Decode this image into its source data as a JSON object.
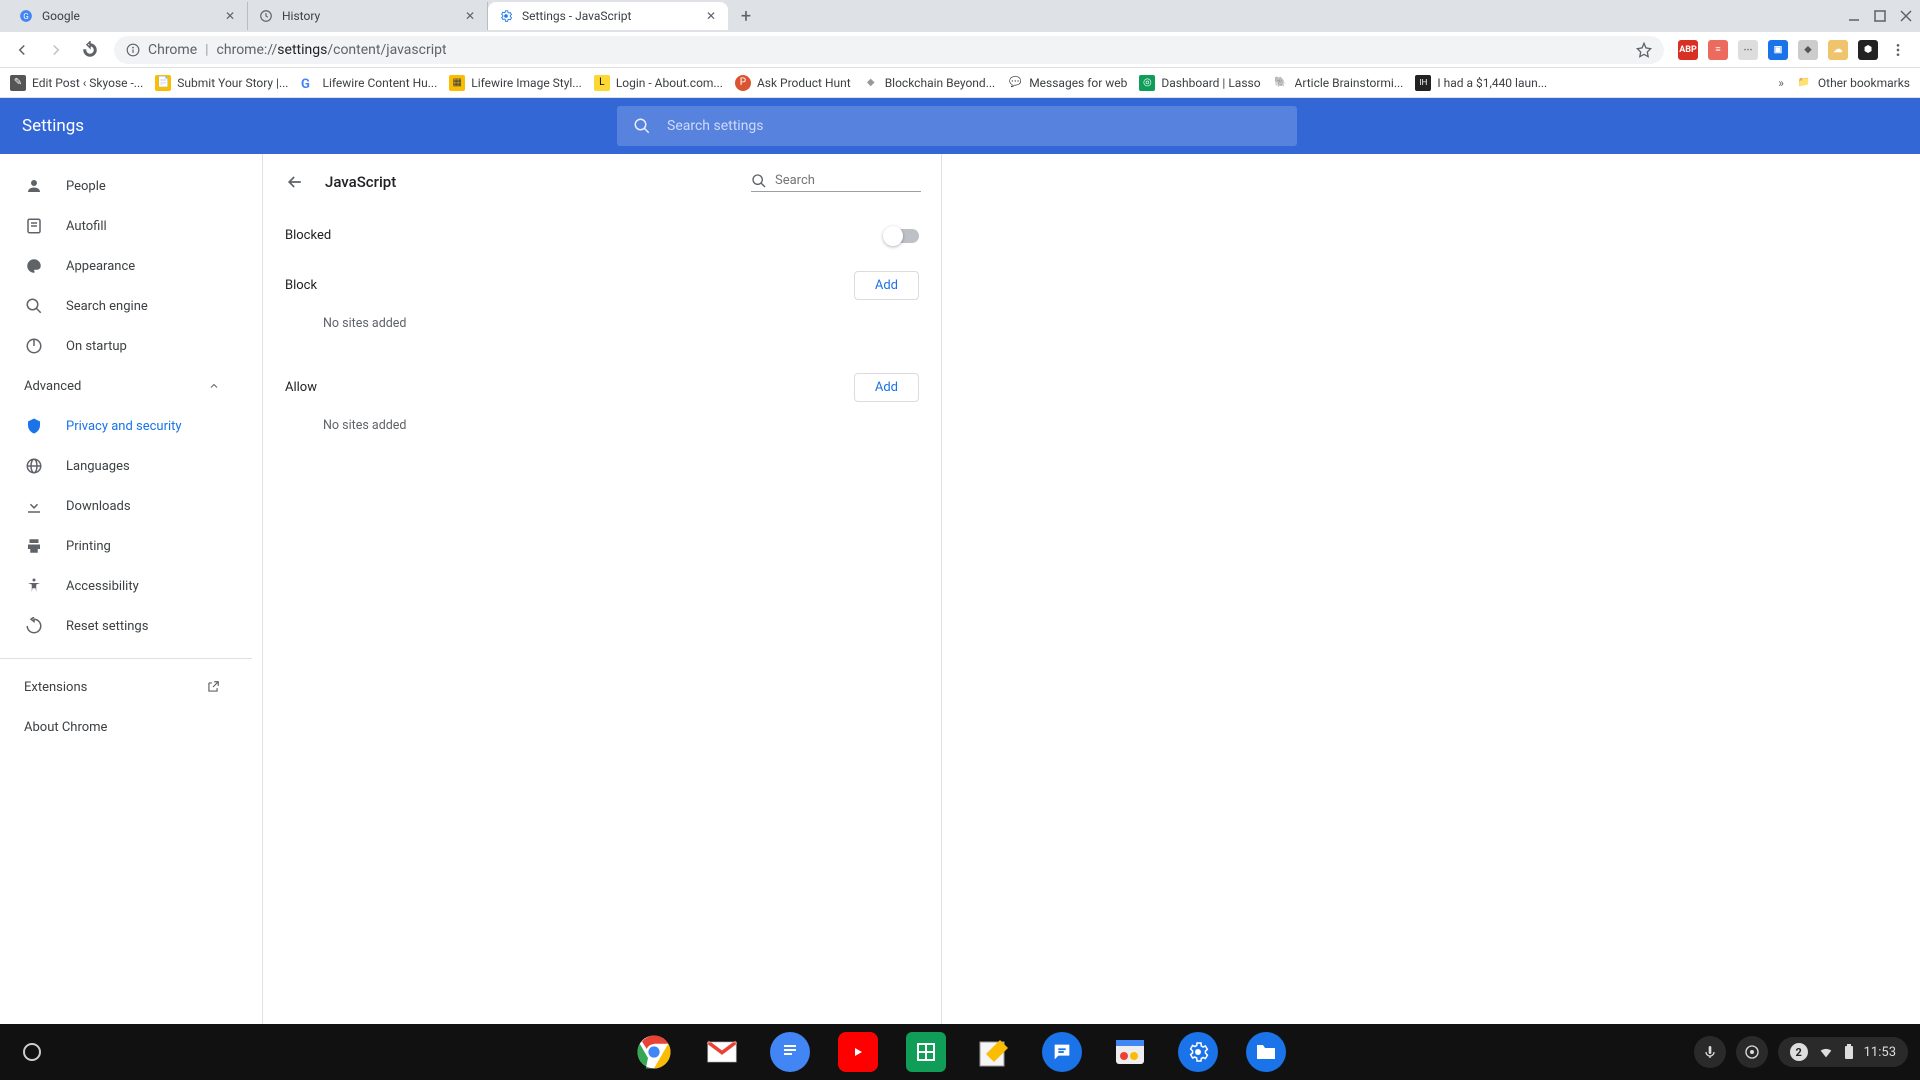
{
  "tabs": [
    {
      "title": "Google"
    },
    {
      "title": "History"
    },
    {
      "title": "Settings - JavaScript"
    }
  ],
  "omnibox": {
    "prefix": "Chrome",
    "path_prefix": "chrome://",
    "path_bold": "settings",
    "path_suffix": "/content/javascript"
  },
  "bookmarks": [
    {
      "label": "Edit Post ‹ Skyose -..."
    },
    {
      "label": "Submit Your Story |..."
    },
    {
      "label": "Lifewire Content Hu..."
    },
    {
      "label": "Lifewire Image Styl..."
    },
    {
      "label": "Login - About.com..."
    },
    {
      "label": "Ask Product Hunt"
    },
    {
      "label": "Blockchain Beyond..."
    },
    {
      "label": "Messages for web"
    },
    {
      "label": "Dashboard | Lasso"
    },
    {
      "label": "Article Brainstormi..."
    },
    {
      "label": "I had a $1,440 laun..."
    }
  ],
  "other_bookmarks_label": "Other bookmarks",
  "header": {
    "title": "Settings",
    "search_placeholder": "Search settings"
  },
  "sidebar": {
    "items": [
      {
        "label": "People"
      },
      {
        "label": "Autofill"
      },
      {
        "label": "Appearance"
      },
      {
        "label": "Search engine"
      },
      {
        "label": "On startup"
      }
    ],
    "advanced_label": "Advanced",
    "adv_items": [
      {
        "label": "Privacy and security"
      },
      {
        "label": "Languages"
      },
      {
        "label": "Downloads"
      },
      {
        "label": "Printing"
      },
      {
        "label": "Accessibility"
      },
      {
        "label": "Reset settings"
      }
    ],
    "extensions_label": "Extensions",
    "about_label": "About Chrome"
  },
  "content": {
    "title": "JavaScript",
    "search_placeholder": "Search",
    "blocked_label": "Blocked",
    "block_label": "Block",
    "allow_label": "Allow",
    "add_label": "Add",
    "no_sites_label": "No sites added"
  },
  "tray": {
    "time": "11:53",
    "badge": "2"
  }
}
